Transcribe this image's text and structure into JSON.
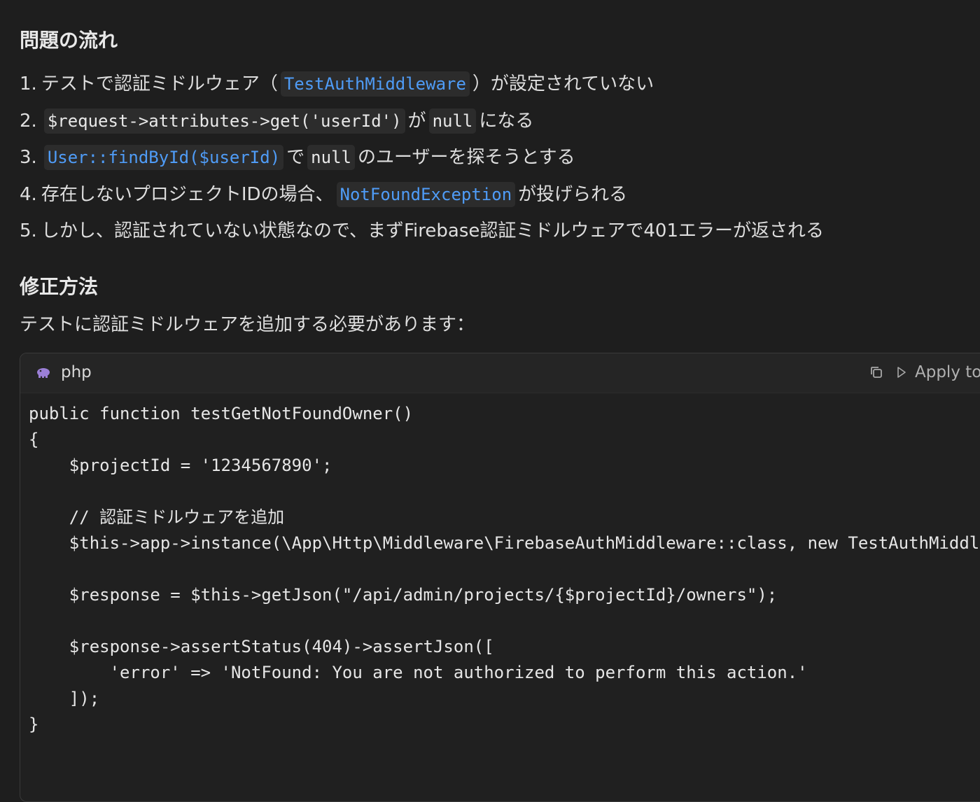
{
  "problem": {
    "heading": "問題の流れ",
    "items": [
      {
        "num": "1.",
        "pre": "テストで認証ミドルウェア（",
        "code": "TestAuthMiddleware",
        "post": "）が設定されていない"
      },
      {
        "num": "2.",
        "code1": "$request->attributes->get('userId')",
        "mid": "が",
        "code2": "null",
        "post": "になる"
      },
      {
        "num": "3.",
        "code1": "User::findById($userId)",
        "mid": "で",
        "code2": "null",
        "post": "のユーザーを探そうとする"
      },
      {
        "num": "4.",
        "pre": "存在しないプロジェクトIDの場合、",
        "code": "NotFoundException",
        "post": "が投げられる"
      },
      {
        "num": "5.",
        "text": "しかし、認証されていない状態なので、まずFirebase認証ミドルウェアで401エラーが返される"
      }
    ]
  },
  "fix": {
    "heading": "修正方法",
    "description": "テストに認証ミドルウェアを追加する必要があります："
  },
  "code_block": {
    "language": "php",
    "language_icon": "elephant-icon",
    "copy_icon": "copy-icon",
    "apply_label": "Apply to",
    "lines": [
      "public function testGetNotFoundOwner()",
      "{",
      "    $projectId = '1234567890';",
      "",
      "    // 認証ミドルウェアを追加",
      "    $this->app->instance(\\App\\Http\\Middleware\\FirebaseAuthMiddleware::class, new TestAuthMiddleware());",
      "",
      "    $response = $this->getJson(\"/api/admin/projects/{$projectId}/owners\");",
      "",
      "    $response->assertStatus(404)->assertJson([",
      "        'error' => 'NotFound: You are not authorized to perform this action.'",
      "    ]);",
      "}"
    ]
  },
  "colors": {
    "background": "#1e1e1e",
    "link_code": "#4f9cf7",
    "inline_code_bg": "#2c2c2c",
    "php_icon": "#9b7fd6"
  }
}
